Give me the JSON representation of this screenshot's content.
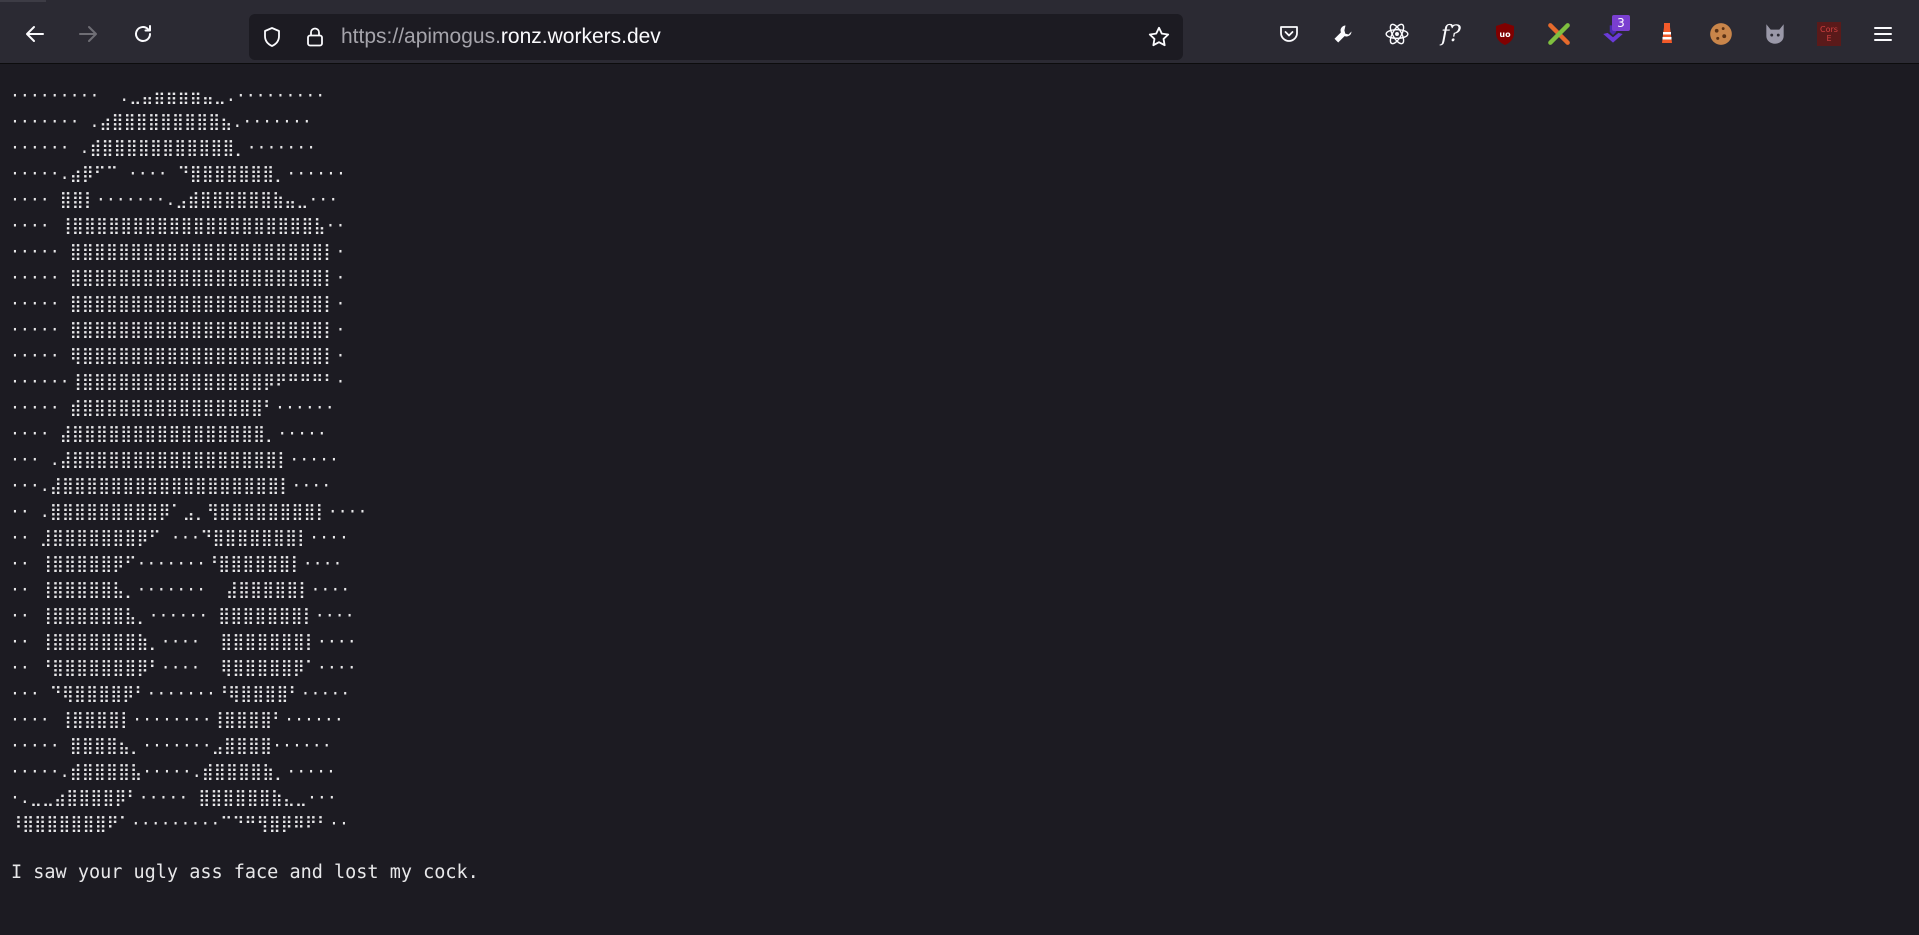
{
  "browser": {
    "url_prefix": "https://apimogus.",
    "url_host": "ronz.workers.dev"
  },
  "extensions": [
    {
      "name": "pocket-icon"
    },
    {
      "name": "wrench-icon"
    },
    {
      "name": "react-devtools-icon"
    },
    {
      "name": "font-finder-icon",
      "label": "f?"
    },
    {
      "name": "ublock-icon"
    },
    {
      "name": "crossed-tools-icon"
    },
    {
      "name": "download-extension-icon",
      "badge": "3"
    },
    {
      "name": "lighthouse-icon"
    },
    {
      "name": "cookie-icon"
    },
    {
      "name": "cat-icon"
    },
    {
      "name": "cors-extension-icon",
      "label": "Cors\nE"
    }
  ],
  "page": {
    "ascii_art": [
      "·········  .⣀⣤⣶⣶⣶⣶⣤⣀.·········",
      "······· .⣴⣿⣿⣿⣿⣿⣿⣿⣿⣿⣦.·······",
      "······ .⣾⣿⣿⣿⣿⣿⣿⣿⣿⣿⣿⣿⡀·······",
      "·····.⣴⡿⠋⠉ ···· ⠙⣿⣿⣿⣿⣿⣿⣿⡀······",
      "···· ⣿⣿⡇·······.⣠⣾⣿⣿⣿⣿⣿⣿⣷⣤⣀···",
      "···· ⢸⣿⣿⣿⣿⣿⣿⣿⣿⣿⣿⣿⣿⣿⣿⣿⣿⣿⣿⣿⣿⣧··",
      "····· ⣿⣿⣿⣿⣿⣿⣿⣿⣿⣿⣿⣿⣿⣿⣿⣿⣿⣿⣿⣿⣿⡇·",
      "····· ⣿⣿⣿⣿⣿⣿⣿⣿⣿⣿⣿⣿⣿⣿⣿⣿⣿⣿⣿⣿⣿⡇·",
      "····· ⣿⣿⣿⣿⣿⣿⣿⣿⣿⣿⣿⣿⣿⣿⣿⣿⣿⣿⣿⣿⣿⡇·",
      "····· ⣿⣿⣿⣿⣿⣿⣿⣿⣿⣿⣿⣿⣿⣿⣿⣿⣿⣿⣿⣿⣿⡇·",
      "····· ⢿⣿⣿⣿⣿⣿⣿⣿⣿⣿⣿⣿⣿⣿⣿⣿⣿⣿⣿⣿⣿⡇·",
      "······⢸⣿⣿⣿⣿⣿⣿⣿⣿⣿⣿⣿⣿⣿⣿⣿⡿⠟⠛⠛⠛⠃·",
      "····· ⣾⣿⣿⣿⣿⣿⣿⣿⣿⣿⣿⣿⣿⣿⣿⣿⠃······",
      "···· ⣼⣿⣿⣿⣿⣿⣿⣿⣿⣿⣿⣿⣿⣿⣿⣿⣿⡀·····",
      "··· .⣼⣿⣿⣿⣿⣿⣿⣿⣿⣿⣿⣿⣿⣿⣿⣿⣿⣿⡇·····",
      "···.⣼⣿⣿⣿⣿⣿⣿⣿⣿⣿⣿⣿⣿⣿⣿⣿⣿⣿⣿⡇····",
      "·· .⣿⣿⣿⣿⣿⣿⣿⣿⣿⡿⠁⣠⡀⢻⣿⣿⣿⣿⣿⣿⣿⣿⡇····",
      "·· ⣸⣿⣿⣿⣿⣿⣿⣿⡿⠋ ···⠙⣿⣿⣿⣿⣿⣿⣿⡇····",
      "·· ⢸⣿⣿⣿⣿⣿⡿⠋·······⠘⣿⣿⣿⣿⣿⣿⡇····",
      "·· ⢸⣿⣿⣿⣿⣿⣧⡀·······  ⣼⣿⣿⣿⣿⣿⡇····",
      "·· ⢸⣿⣿⣿⣿⣿⣿⣧⡀······ ⣿⣿⣿⣿⣿⣿⣿⡇····",
      "·· ⢸⣿⣿⣿⣿⣿⣿⣿⣷⡀····  ⣿⣿⣿⣿⣿⣿⣿⡇····",
      "·· ⠘⣿⣿⣿⣿⣿⣿⣿⡿⠃····  ⢿⣿⣿⣿⣿⣿⡿⠁····",
      "··· ⠙⢿⣿⣿⣿⣿⡿⠃·······⠘⢿⣿⣿⣿⣿⠃·····",
      "···· ⢸⣿⣿⣿⣿⡇········⢸⣿⣿⣿⣿⠃······",
      "····· ⣿⣿⣿⣿⣦⡀·······⣠⣿⣿⣿⣿······",
      "·····.⣾⣿⣿⣿⣿⣧·····.⣾⣿⣿⣿⣿⣷⡀·····",
      "·.⣀⣀⣴⣿⣿⣿⣿⡿⠃····· ⣿⣿⣿⣿⣿⣿⣷⣄⣀···",
      "⠸⣿⣿⣿⣿⣿⣿⣿⠟⠁·········⠉⠙⠛⢻⣿⡿⠿⠟⠃··"
    ],
    "caption": "I saw your ugly ass face and lost my cock."
  }
}
